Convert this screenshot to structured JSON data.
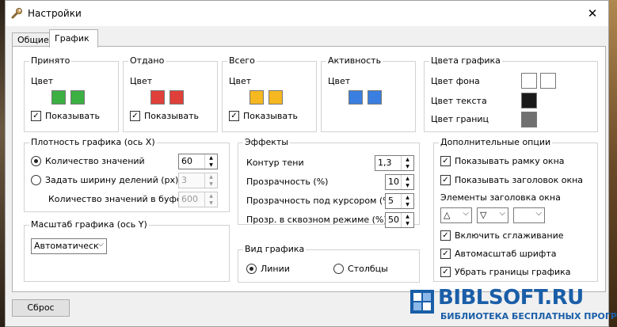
{
  "window": {
    "title": "Настройки"
  },
  "tabs": [
    {
      "label": "Общие"
    },
    {
      "label": "График"
    }
  ],
  "accepted": {
    "title": "Принято",
    "color_label": "Цвет",
    "show_label": "Показывать",
    "color": "#3cb043"
  },
  "sent": {
    "title": "Отдано",
    "color_label": "Цвет",
    "show_label": "Показывать",
    "color": "#e0403a"
  },
  "total": {
    "title": "Всего",
    "color_label": "Цвет",
    "show_label": "Показывать",
    "color": "#f5b820"
  },
  "activity": {
    "title": "Активность",
    "color_label": "Цвет",
    "color": "#3a7fe0"
  },
  "graph_colors": {
    "title": "Цвета графика",
    "bg_label": "Цвет фона",
    "text_label": "Цвет текста",
    "border_label": "Цвет границ",
    "bg_color": "#ffffff",
    "text_color": "#1a1a1a",
    "border_color": "#707070"
  },
  "density": {
    "title": "Плотность графика (ось X)",
    "count_label": "Количество значений",
    "count_value": "60",
    "width_label": "Задать ширину делений (px)",
    "width_value": "3",
    "buffer_label": "Количество значений в буфере",
    "buffer_value": "600"
  },
  "effects": {
    "title": "Эффекты",
    "shadow_label": "Контур тени",
    "shadow_value": "1,3",
    "opacity_label": "Прозрачность (%)",
    "opacity_value": "10",
    "hover_label": "Прозрачность под курсором (%)",
    "hover_value": "5",
    "through_label": "Прозр. в сквозном режиме (%)",
    "through_value": "50"
  },
  "extra": {
    "title": "Дополнительные опции",
    "frame_label": "Показывать рамку окна",
    "header_label": "Показывать заголовок окна",
    "header_elements_label": "Элементы заголовка окна",
    "combo1": "△",
    "combo2": "▽",
    "combo3": "",
    "smooth_label": "Включить сглаживание",
    "autofont_label": "Автомасштаб шрифта",
    "noborder_label": "Убрать границы графика"
  },
  "scale": {
    "title": "Масштаб графика (ось Y)",
    "value": "Автоматическ"
  },
  "view": {
    "title": "Вид графика",
    "lines_label": "Линии",
    "bars_label": "Столбцы"
  },
  "reset_label": "Сброс",
  "watermark": {
    "text": "BIBLSOFT.RU",
    "sub": "БИБЛИОТЕКА БЕСПЛАТНЫХ ПРОГРАММ"
  }
}
